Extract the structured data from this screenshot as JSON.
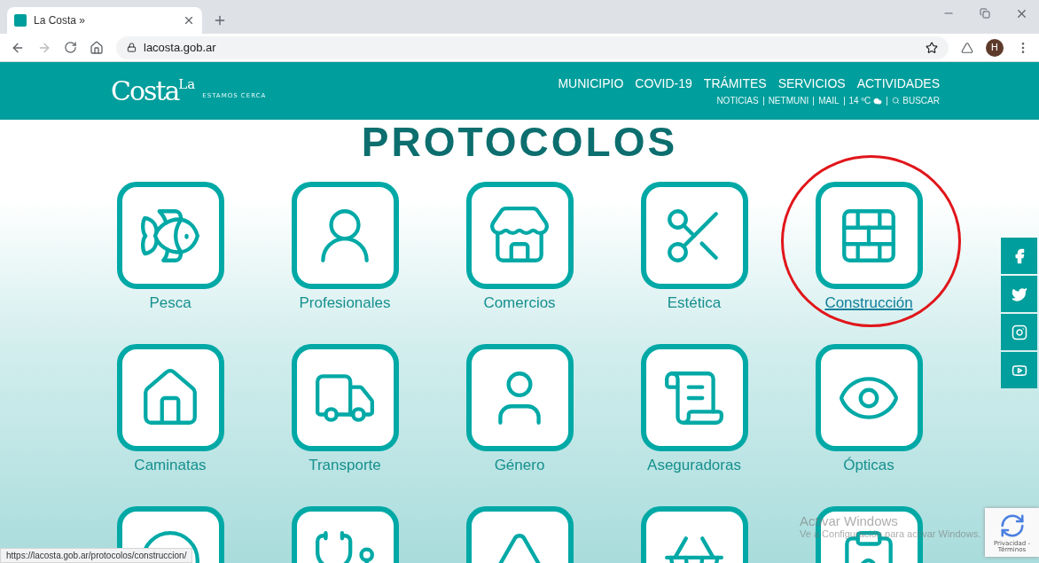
{
  "browser": {
    "tab_title": "La Costa »",
    "url": "lacosta.gob.ar",
    "avatar": "H",
    "status_url": "https://lacosta.gob.ar/protocolos/construccion/"
  },
  "header": {
    "logo_small": "La",
    "logo_main": "Costa",
    "tagline": "ESTAMOS CERCA",
    "main_nav": [
      "MUNICIPIO",
      "COVID-19",
      "TRÁMITES",
      "SERVICIOS",
      "ACTIVIDADES"
    ],
    "secondary_nav": [
      {
        "kind": "link",
        "label": "NOTICIAS"
      },
      {
        "kind": "link",
        "label": "NETMUNI"
      },
      {
        "kind": "link",
        "label": "MAIL"
      },
      {
        "kind": "weather",
        "label": "14 ºC"
      },
      {
        "kind": "search",
        "label": "BUSCAR"
      }
    ]
  },
  "title": "PROTOCOLOS",
  "protocols": [
    {
      "label": "Pesca",
      "hovered": false,
      "circled": false
    },
    {
      "label": "Profesionales",
      "hovered": false,
      "circled": false
    },
    {
      "label": "Comercios",
      "hovered": false,
      "circled": false
    },
    {
      "label": "Estética",
      "hovered": false,
      "circled": false
    },
    {
      "label": "Construcción",
      "hovered": true,
      "circled": true
    },
    {
      "label": "Caminatas",
      "hovered": false,
      "circled": false
    },
    {
      "label": "Transporte",
      "hovered": false,
      "circled": false
    },
    {
      "label": "Género",
      "hovered": false,
      "circled": false
    },
    {
      "label": "Aseguradoras",
      "hovered": false,
      "circled": false
    },
    {
      "label": "Ópticas",
      "hovered": false,
      "circled": false
    },
    {
      "circled": false
    },
    {
      "circled": false
    },
    {
      "circled": false
    },
    {
      "circled": false
    },
    {
      "circled": false
    }
  ],
  "windows_notice": {
    "title": "Activar Windows",
    "text": "Ve a Configuración para activar Windows."
  },
  "recaptcha": {
    "text": "Privacidad - Términos"
  }
}
